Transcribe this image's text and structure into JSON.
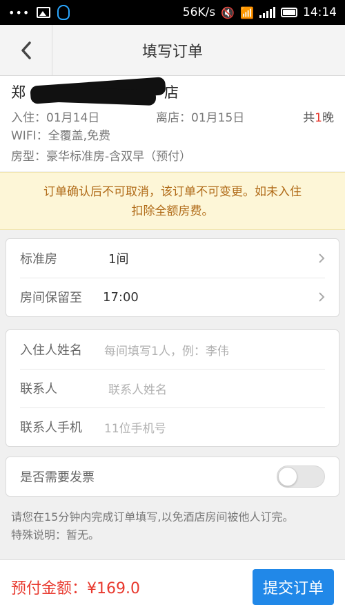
{
  "status_bar": {
    "dots": "•••",
    "network_speed": "56K/s",
    "time": "14:14"
  },
  "navbar": {
    "back_icon": "chevron-left",
    "title": "填写订单"
  },
  "hotel": {
    "name_visible": "郑",
    "name_suffix": "店",
    "check_in": "入住：01月14日",
    "check_out": "离店：01月15日",
    "nights_prefix": "共",
    "nights_count": "1",
    "nights_suffix": "晚",
    "wifi": "WIFI：全覆盖,免费",
    "room_type": "房型：豪华标准房-含双早（预付）"
  },
  "notice": {
    "line1": "订单确认后不可取消，该订单不可变更。如未入住",
    "line2": "扣除全额房费。"
  },
  "room_card": {
    "rows": [
      {
        "label": "标准房",
        "value": "1间"
      },
      {
        "label": "房间保留至",
        "value": "17:00"
      }
    ]
  },
  "guest_card": {
    "rows": [
      {
        "label": "入住人姓名",
        "placeholder": "每间填写1人，例：李伟"
      },
      {
        "label": "联系人",
        "placeholder": "联系人姓名"
      },
      {
        "label": "联系人手机",
        "placeholder": "11位手机号"
      }
    ]
  },
  "invoice": {
    "label": "是否需要发票",
    "enabled": false
  },
  "tips": {
    "line1": "请您在15分钟内完成订单填写,以免酒店房间被他人订完。",
    "line2": "特殊说明：暂无。"
  },
  "footer": {
    "total_label": "预付金额：¥169.0",
    "submit_label": "提交订单"
  },
  "colors": {
    "accent_red": "#e8382d",
    "button_blue": "#2188e8",
    "notice_bg": "#fdf6d7",
    "notice_text": "#b06a17"
  }
}
